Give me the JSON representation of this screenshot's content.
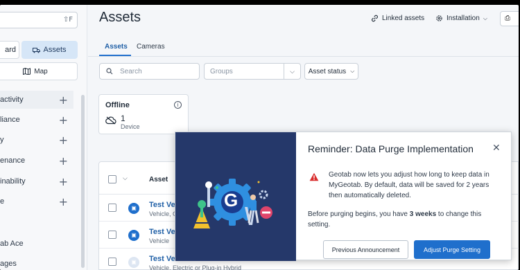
{
  "sidebar": {
    "search_shortcut": "⇧F",
    "tabs": [
      "ard",
      "Assets"
    ],
    "map_label": "Map",
    "items": [
      {
        "label": "activity"
      },
      {
        "label": "liance"
      },
      {
        "label": "y"
      },
      {
        "label": "enance"
      },
      {
        "label": "inability"
      },
      {
        "label": "e"
      }
    ],
    "footer_items": [
      "ab Ace",
      "ages"
    ]
  },
  "header": {
    "title": "Assets",
    "linked_assets": "Linked assets",
    "installation": "Installation",
    "print_glyph": "⎙"
  },
  "tabs": [
    {
      "label": "Assets",
      "selected": true
    },
    {
      "label": "Cameras",
      "selected": false
    }
  ],
  "filters": {
    "search_placeholder": "Search",
    "groups_placeholder": "Groups",
    "status_label": "Asset status"
  },
  "summary_card": {
    "title": "Offline",
    "count": "1",
    "unit": "Device"
  },
  "table": {
    "column_asset": "Asset",
    "rows": [
      {
        "name": "Test Veh",
        "sub": "Vehicle, G",
        "dim": false
      },
      {
        "name": "Test Veh",
        "sub": "Vehicle",
        "dim": false
      },
      {
        "name": "Test Veh",
        "sub": "Vehicle, Electric or Plug-in Hybrid",
        "dim": true
      }
    ]
  },
  "modal": {
    "title": "Reminder: Data Purge Implementation",
    "close": "✕",
    "message": "Geotab now lets you adjust how long to keep data in MyGeotab. By default, data will be saved for 2 years then automatically deleted.",
    "before_text": "Before purging begins, you have ",
    "weeks": "3 weeks",
    "after_text": " to change this setting.",
    "secondary_button": "Previous Announcement",
    "primary_button": "Adjust Purge Setting",
    "logo_letter": "G"
  },
  "colors": {
    "accent": "#1f6fcc",
    "modal_art_bg": "#25386a",
    "warning": "#d92d2d"
  }
}
